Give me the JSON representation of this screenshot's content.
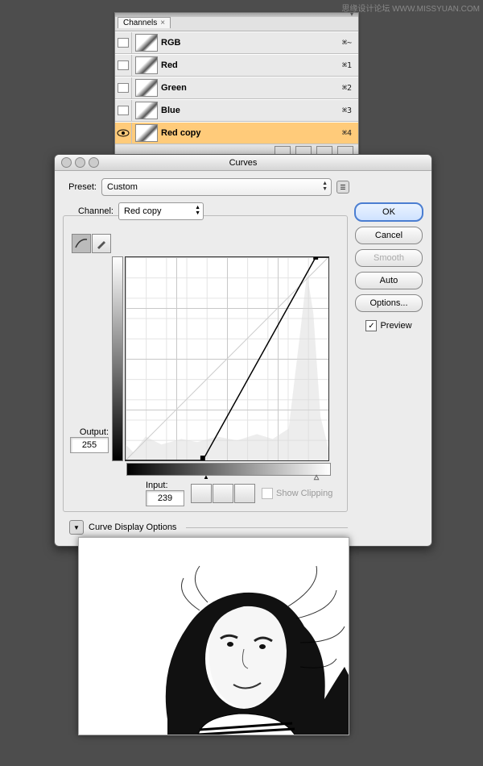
{
  "watermark": "思缘设计论坛 WWW.MISSYUAN.COM",
  "channels_panel": {
    "tab_label": "Channels",
    "rows": [
      {
        "name": "RGB",
        "shortcut": "⌘~",
        "visible": false,
        "selected": false
      },
      {
        "name": "Red",
        "shortcut": "⌘1",
        "visible": false,
        "selected": false
      },
      {
        "name": "Green",
        "shortcut": "⌘2",
        "visible": false,
        "selected": false
      },
      {
        "name": "Blue",
        "shortcut": "⌘3",
        "visible": false,
        "selected": false
      },
      {
        "name": "Red copy",
        "shortcut": "⌘4",
        "visible": true,
        "selected": true
      }
    ]
  },
  "curves_dialog": {
    "title": "Curves",
    "preset_label": "Preset:",
    "preset_value": "Custom",
    "channel_label": "Channel:",
    "channel_value": "Red copy",
    "output_label": "Output:",
    "output_value": "255",
    "input_label": "Input:",
    "input_value": "239",
    "show_clipping_label": "Show Clipping",
    "curve_display_options": "Curve Display Options",
    "buttons": {
      "ok": "OK",
      "cancel": "Cancel",
      "smooth": "Smooth",
      "auto": "Auto",
      "options": "Options..."
    },
    "preview_label": "Preview",
    "preview_checked": true
  },
  "chart_data": {
    "type": "line",
    "title": "Curves",
    "xlabel": "Input",
    "ylabel": "Output",
    "xlim": [
      0,
      255
    ],
    "ylim": [
      0,
      255
    ],
    "series": [
      {
        "name": "curve",
        "x": [
          0,
          97,
          239,
          255
        ],
        "y": [
          0,
          0,
          255,
          255
        ]
      },
      {
        "name": "baseline",
        "x": [
          0,
          255
        ],
        "y": [
          0,
          255
        ]
      }
    ],
    "black_slider": 97,
    "white_slider": 239
  }
}
